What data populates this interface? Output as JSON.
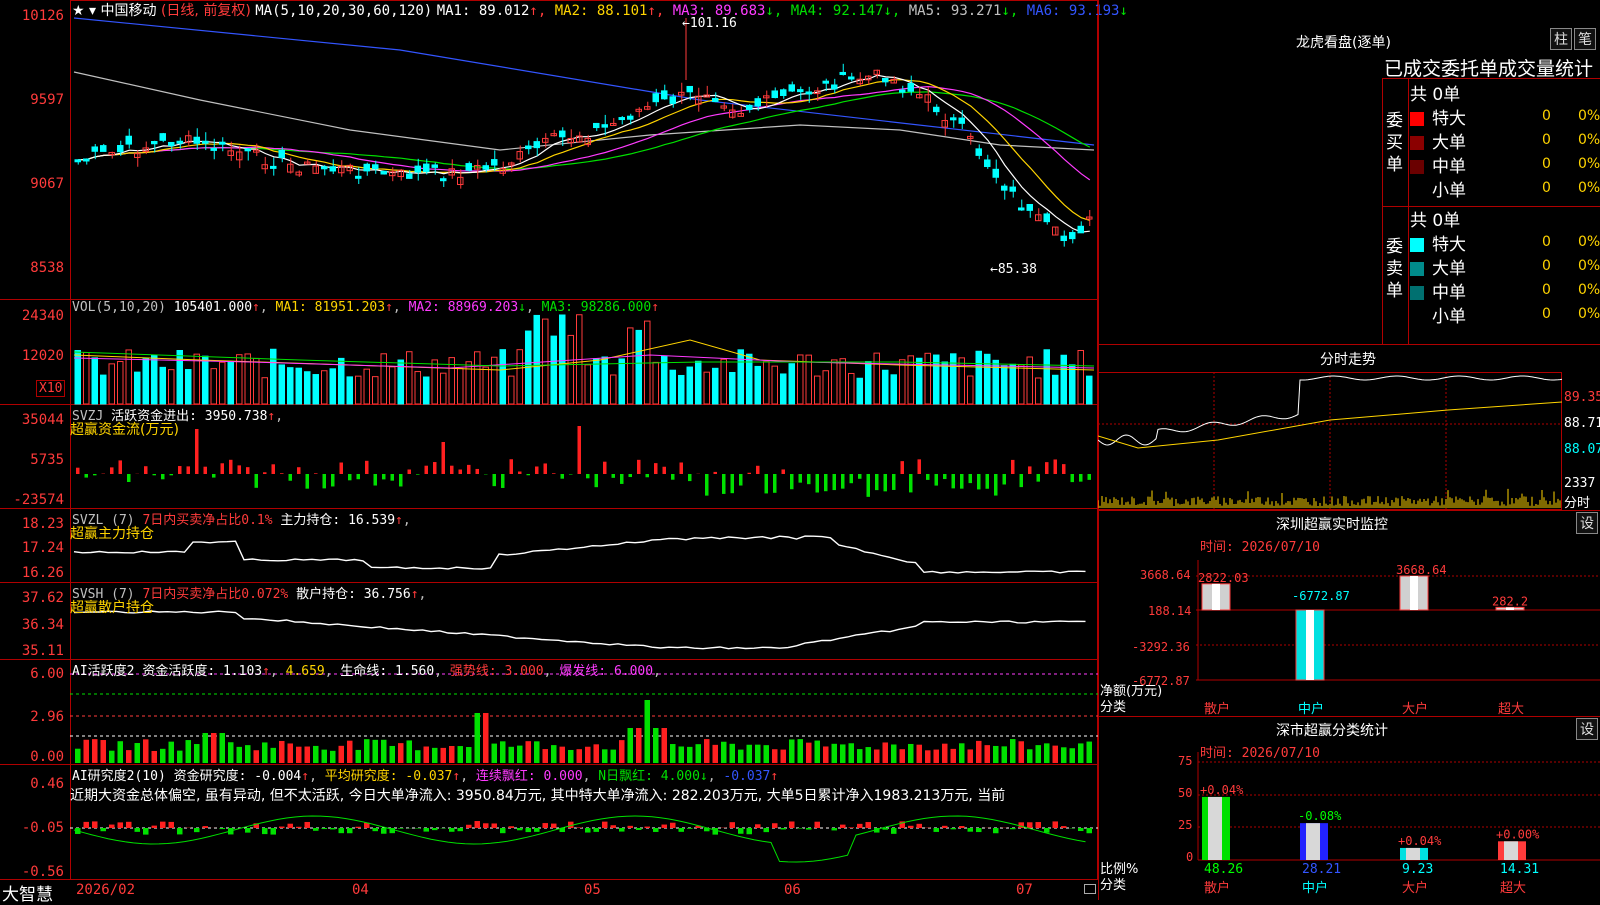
{
  "stock": {
    "name": "中国移动",
    "mode": "(日线, 前复权)",
    "ma_label": "MA(5,10,20,30,60,120)",
    "ma": [
      {
        "label": "MA1:",
        "value": "89.012",
        "arrow": "↑",
        "color": "#ffffff"
      },
      {
        "label": "MA2:",
        "value": "88.101",
        "arrow": "↑",
        "color": "#ffd400"
      },
      {
        "label": "MA3:",
        "value": "89.683",
        "arrow": "↓",
        "color": "#ff3bff"
      },
      {
        "label": "MA4:",
        "value": "92.147",
        "arrow": "↓",
        "color": "#00e000"
      },
      {
        "label": "MA5:",
        "value": "93.271",
        "arrow": "↓",
        "color": "#c0c0c0"
      },
      {
        "label": "MA6:",
        "value": "93.193",
        "arrow": "↓",
        "color": "#3355ff"
      }
    ],
    "high_label": "←101.16",
    "low_label": "←85.38",
    "yticks": [
      "10126",
      "9597",
      "9067",
      "8538"
    ]
  },
  "vol": {
    "label": "VOL(5,10,20)",
    "value": "105401.000",
    "ma1": "MA1: 81951.203",
    "ma2": "MA2: 88969.203",
    "ma3": "MA3: 98286.000",
    "yticks": [
      "24340",
      "12020"
    ],
    "unit": "X10"
  },
  "svzj": {
    "label": "SVZJ",
    "text": "活跃资金进出: 3950.738",
    "sub": "超赢资金流(万元)",
    "yticks": [
      "35044",
      "5735",
      "-23574"
    ]
  },
  "svzl": {
    "label": "SVZL (7)",
    "desc": "7日内买卖净占比0.1%",
    "text": "主力持仓: 16.539",
    "sub": "超赢主力持仓",
    "yticks": [
      "18.23",
      "17.24",
      "16.26"
    ]
  },
  "svsh": {
    "label": "SVSH (7)",
    "desc": "7日内买卖净占比0.072%",
    "text": "散户持仓: 36.756",
    "sub": "超赢散户持仓",
    "yticks": [
      "37.62",
      "36.34",
      "35.11"
    ]
  },
  "ai1": {
    "label": "AI活跃度2",
    "t1": "资金活跃度: 1.103",
    "t2": "4.659",
    "t3": "生命线: 1.560",
    "t4": "强势线: 3.000",
    "t5": "爆发线: 6.000",
    "yticks": [
      "6.00",
      "2.96",
      "0.00"
    ]
  },
  "ai2": {
    "label": "AI研究度2(10)",
    "t1": "资金研究度: -0.004",
    "t2": "平均研究度: -0.037",
    "t3": "连续飘红: 0.000",
    "t4": "N日飘红: 4.000",
    "t5": "-0.037",
    "comment": "近期大资金总体偏空, 虽有异动, 但不太活跃, 今日大单净流入: 3950.84万元, 其中特大单净流入: 282.203万元, 大单5日累计净入1983.213万元, 当前",
    "yticks": [
      "0.46",
      "-0.05",
      "-0.56"
    ]
  },
  "xaxis": {
    "brand": "大智慧",
    "labels": [
      "2026/02",
      "04",
      "05",
      "06",
      "07"
    ]
  },
  "longhu": {
    "title": "龙虎看盘(逐单)",
    "btn1": "柱",
    "btn2": "笔",
    "header": "已成交委托单成交量统计",
    "buy_label": "委买单",
    "sell_label": "委卖单",
    "buy_total": "共 0单",
    "sell_total": "共 0单",
    "buy_rows": [
      {
        "name": "特大",
        "value": "0",
        "pct": "0%",
        "color": "#ff0000"
      },
      {
        "name": "大单",
        "value": "0",
        "pct": "0%",
        "color": "#8b0000"
      },
      {
        "name": "中单",
        "value": "0",
        "pct": "0%",
        "color": "#6a0000"
      },
      {
        "name": "小单",
        "value": "0",
        "pct": "0%",
        "color": "#000000"
      }
    ],
    "sell_rows": [
      {
        "name": "特大",
        "value": "0",
        "pct": "0%",
        "color": "#00ffff"
      },
      {
        "name": "大单",
        "value": "0",
        "pct": "0%",
        "color": "#008b8b"
      },
      {
        "name": "中单",
        "value": "0",
        "pct": "0%",
        "color": "#007070"
      },
      {
        "name": "小单",
        "value": "0",
        "pct": "0%",
        "color": "#000000"
      }
    ]
  },
  "intraday": {
    "title": "分时走势",
    "yticks": [
      "89.35",
      "88.71",
      "88.07"
    ],
    "vol_label": "2337",
    "vol_unit": "分时"
  },
  "monitor": {
    "title": "深圳超赢实时监控",
    "btn": "设",
    "time": "时间: 2026/07/10",
    "yticks": [
      "3668.64",
      "188.14",
      "-3292.36",
      "-6772.87"
    ],
    "ylabel1": "净额(万元)",
    "ylabel2": "分类",
    "bars": [
      {
        "cat": "散户",
        "value": "2822.03",
        "num": 2822.03
      },
      {
        "cat": "中户",
        "value": "-6772.87",
        "num": -6772.87
      },
      {
        "cat": "大户",
        "value": "3668.64",
        "num": 3668.64
      },
      {
        "cat": "超大",
        "value": "282.2",
        "num": 282.2
      }
    ]
  },
  "stats": {
    "title": "深市超赢分类统计",
    "btn": "设",
    "time": "时间: 2026/07/10",
    "yticks": [
      "75",
      "50",
      "25",
      "0"
    ],
    "ylabel1": "比例%",
    "ylabel2": "分类",
    "bars": [
      {
        "cat": "散户",
        "value": "48.26",
        "num": 48.26,
        "chg": "+0.04%"
      },
      {
        "cat": "中户",
        "value": "28.21",
        "num": 28.21,
        "chg": "-0.08%"
      },
      {
        "cat": "大户",
        "value": "9.23",
        "num": 9.23,
        "chg": "+0.04%"
      },
      {
        "cat": "超大",
        "value": "14.31",
        "num": 14.31,
        "chg": "+0.00%"
      }
    ]
  }
}
